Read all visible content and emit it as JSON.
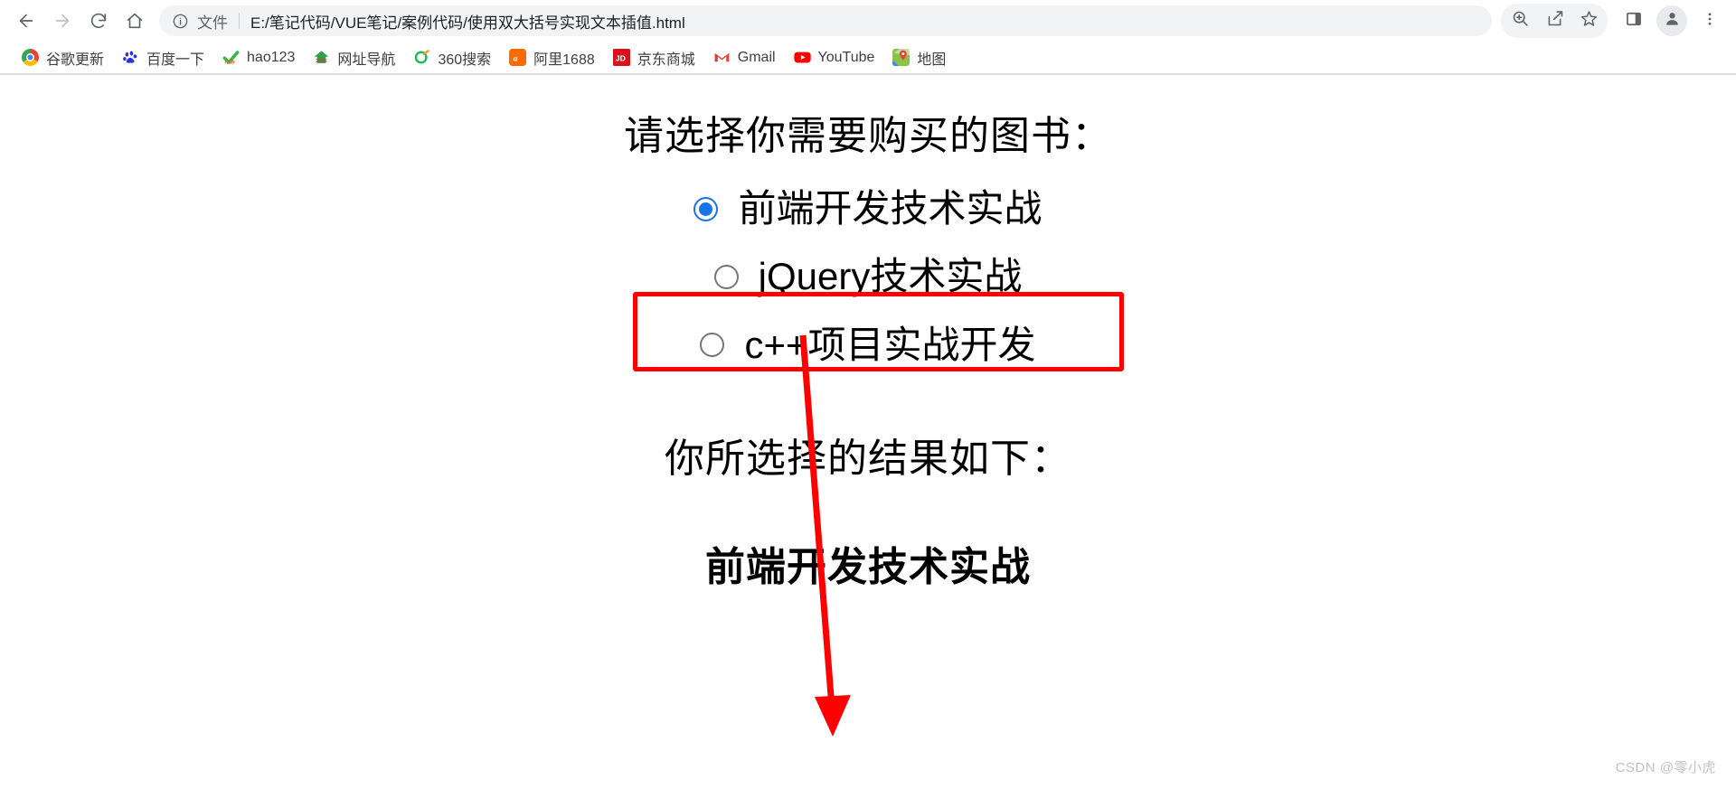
{
  "browser": {
    "nav": {
      "back_label": "Back",
      "forward_label": "Forward",
      "reload_label": "Reload",
      "home_label": "Home"
    },
    "omnibox": {
      "scheme_label": "文件",
      "url": "E:/笔记代码/VUE笔记/案例代码/使用双大括号实现文本插值.html",
      "info_icon": "info-circle-icon"
    },
    "toolbar_right": [
      {
        "name": "zoom-in-icon",
        "label": "Zoom"
      },
      {
        "name": "share-icon",
        "label": "Share"
      },
      {
        "name": "bookmark-star-icon",
        "label": "Bookmark this tab"
      },
      {
        "name": "side-panel-icon",
        "label": "Side panel"
      },
      {
        "name": "profile-avatar-icon",
        "label": "Profile"
      },
      {
        "name": "more-menu-icon",
        "label": "Customize and control"
      }
    ],
    "bookmarks": [
      {
        "label": "谷歌更新",
        "icon": "chrome-icon"
      },
      {
        "label": "百度一下",
        "icon": "baidu-icon"
      },
      {
        "label": "hao123",
        "icon": "hao123-icon"
      },
      {
        "label": "网址导航",
        "icon": "2345-icon"
      },
      {
        "label": "360搜索",
        "icon": "360-icon"
      },
      {
        "label": "阿里1688",
        "icon": "alibaba-icon"
      },
      {
        "label": "京东商城",
        "icon": "jd-icon"
      },
      {
        "label": "Gmail",
        "icon": "gmail-icon"
      },
      {
        "label": "YouTube",
        "icon": "youtube-icon"
      },
      {
        "label": "地图",
        "icon": "google-maps-icon"
      }
    ]
  },
  "page": {
    "prompt_title": "请选择你需要购买的图书：",
    "options": [
      {
        "label": "前端开发技术实战",
        "checked": true
      },
      {
        "label": "jQuery技术实战",
        "checked": false
      },
      {
        "label": "c++项目实战开发",
        "checked": false
      }
    ],
    "result_title": "你所选择的结果如下：",
    "result_value": "前端开发技术实战",
    "watermark": "CSDN @零小虎"
  },
  "annotations": {
    "highlight_color": "#fe0000",
    "arrow_color": "#fe0000",
    "accent_color": "#1a73e8"
  }
}
